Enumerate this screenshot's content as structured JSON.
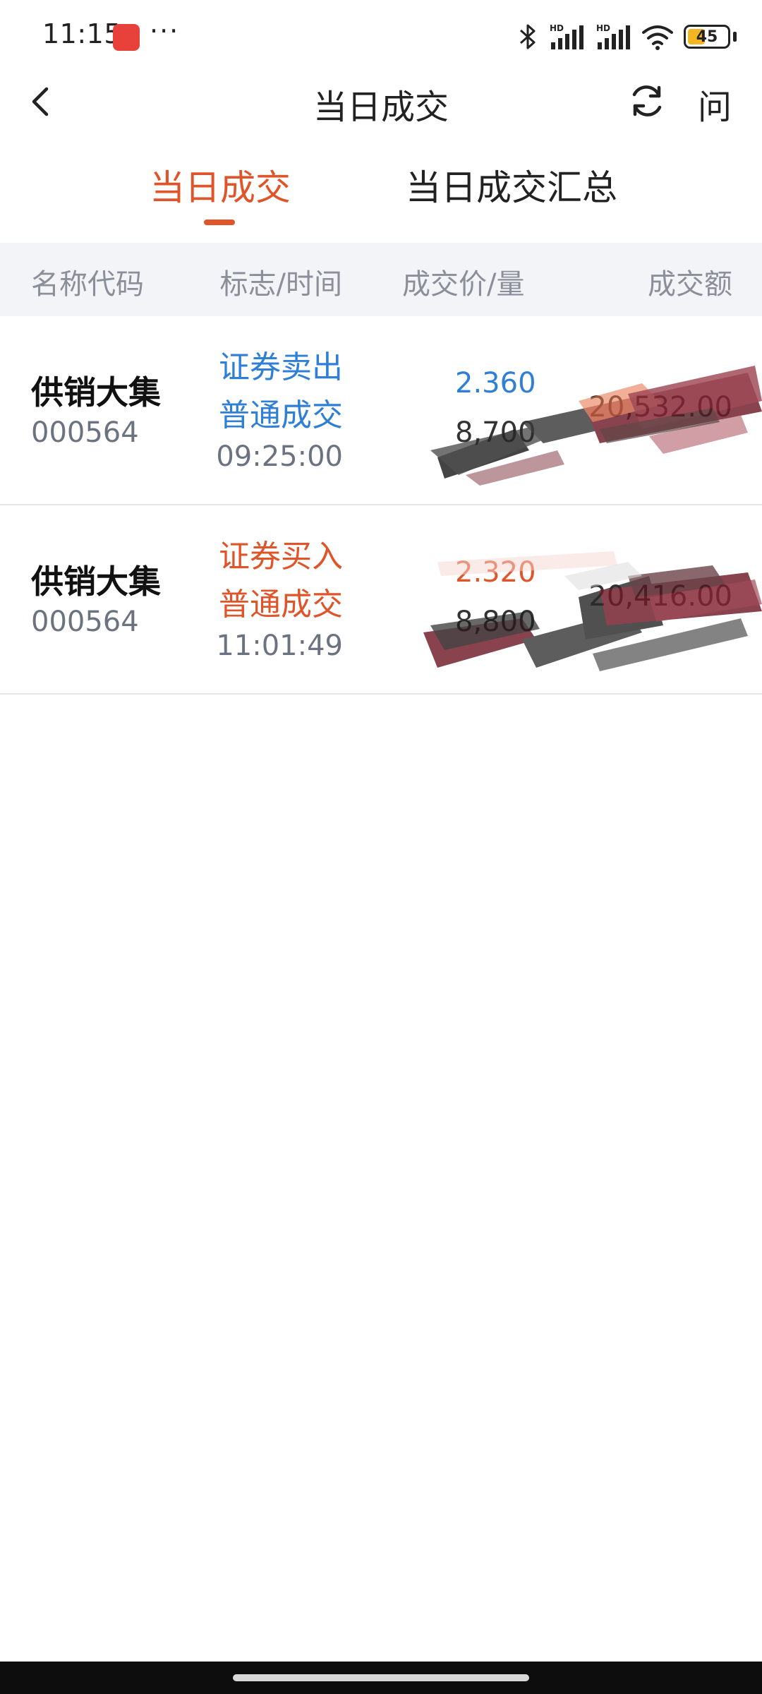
{
  "status_bar": {
    "time": "11:15",
    "more": "···",
    "battery": "45",
    "icons": [
      "bluetooth-icon",
      "signal-hd-icon",
      "signal-hd-icon",
      "wifi-icon",
      "battery-icon"
    ]
  },
  "header": {
    "title": "当日成交",
    "help_label": "问",
    "back_icon": "chevron-left-icon",
    "refresh_icon": "refresh-icon"
  },
  "tabs": [
    {
      "label": "当日成交",
      "active": true
    },
    {
      "label": "当日成交汇总",
      "active": false
    }
  ],
  "columns": [
    "名称代码",
    "标志/时间",
    "成交价/量",
    "成交额"
  ],
  "trades": [
    {
      "name": "供销大集",
      "code": "000564",
      "flag": "证券卖出",
      "type": "普通成交",
      "time": "09:25:00",
      "price": "2.360",
      "qty": "8,700",
      "amount": "20,532.00"
    },
    {
      "name": "供销大集",
      "code": "000564",
      "flag": "证券买入",
      "type": "普通成交",
      "time": "11:01:49",
      "price": "2.320",
      "qty": "8,800",
      "amount": "20,416.00"
    }
  ],
  "colors": {
    "accent": "#e0542a",
    "sell": "#2f7fd6",
    "buy": "#e0542a",
    "header_bg": "#f3f4f8"
  }
}
